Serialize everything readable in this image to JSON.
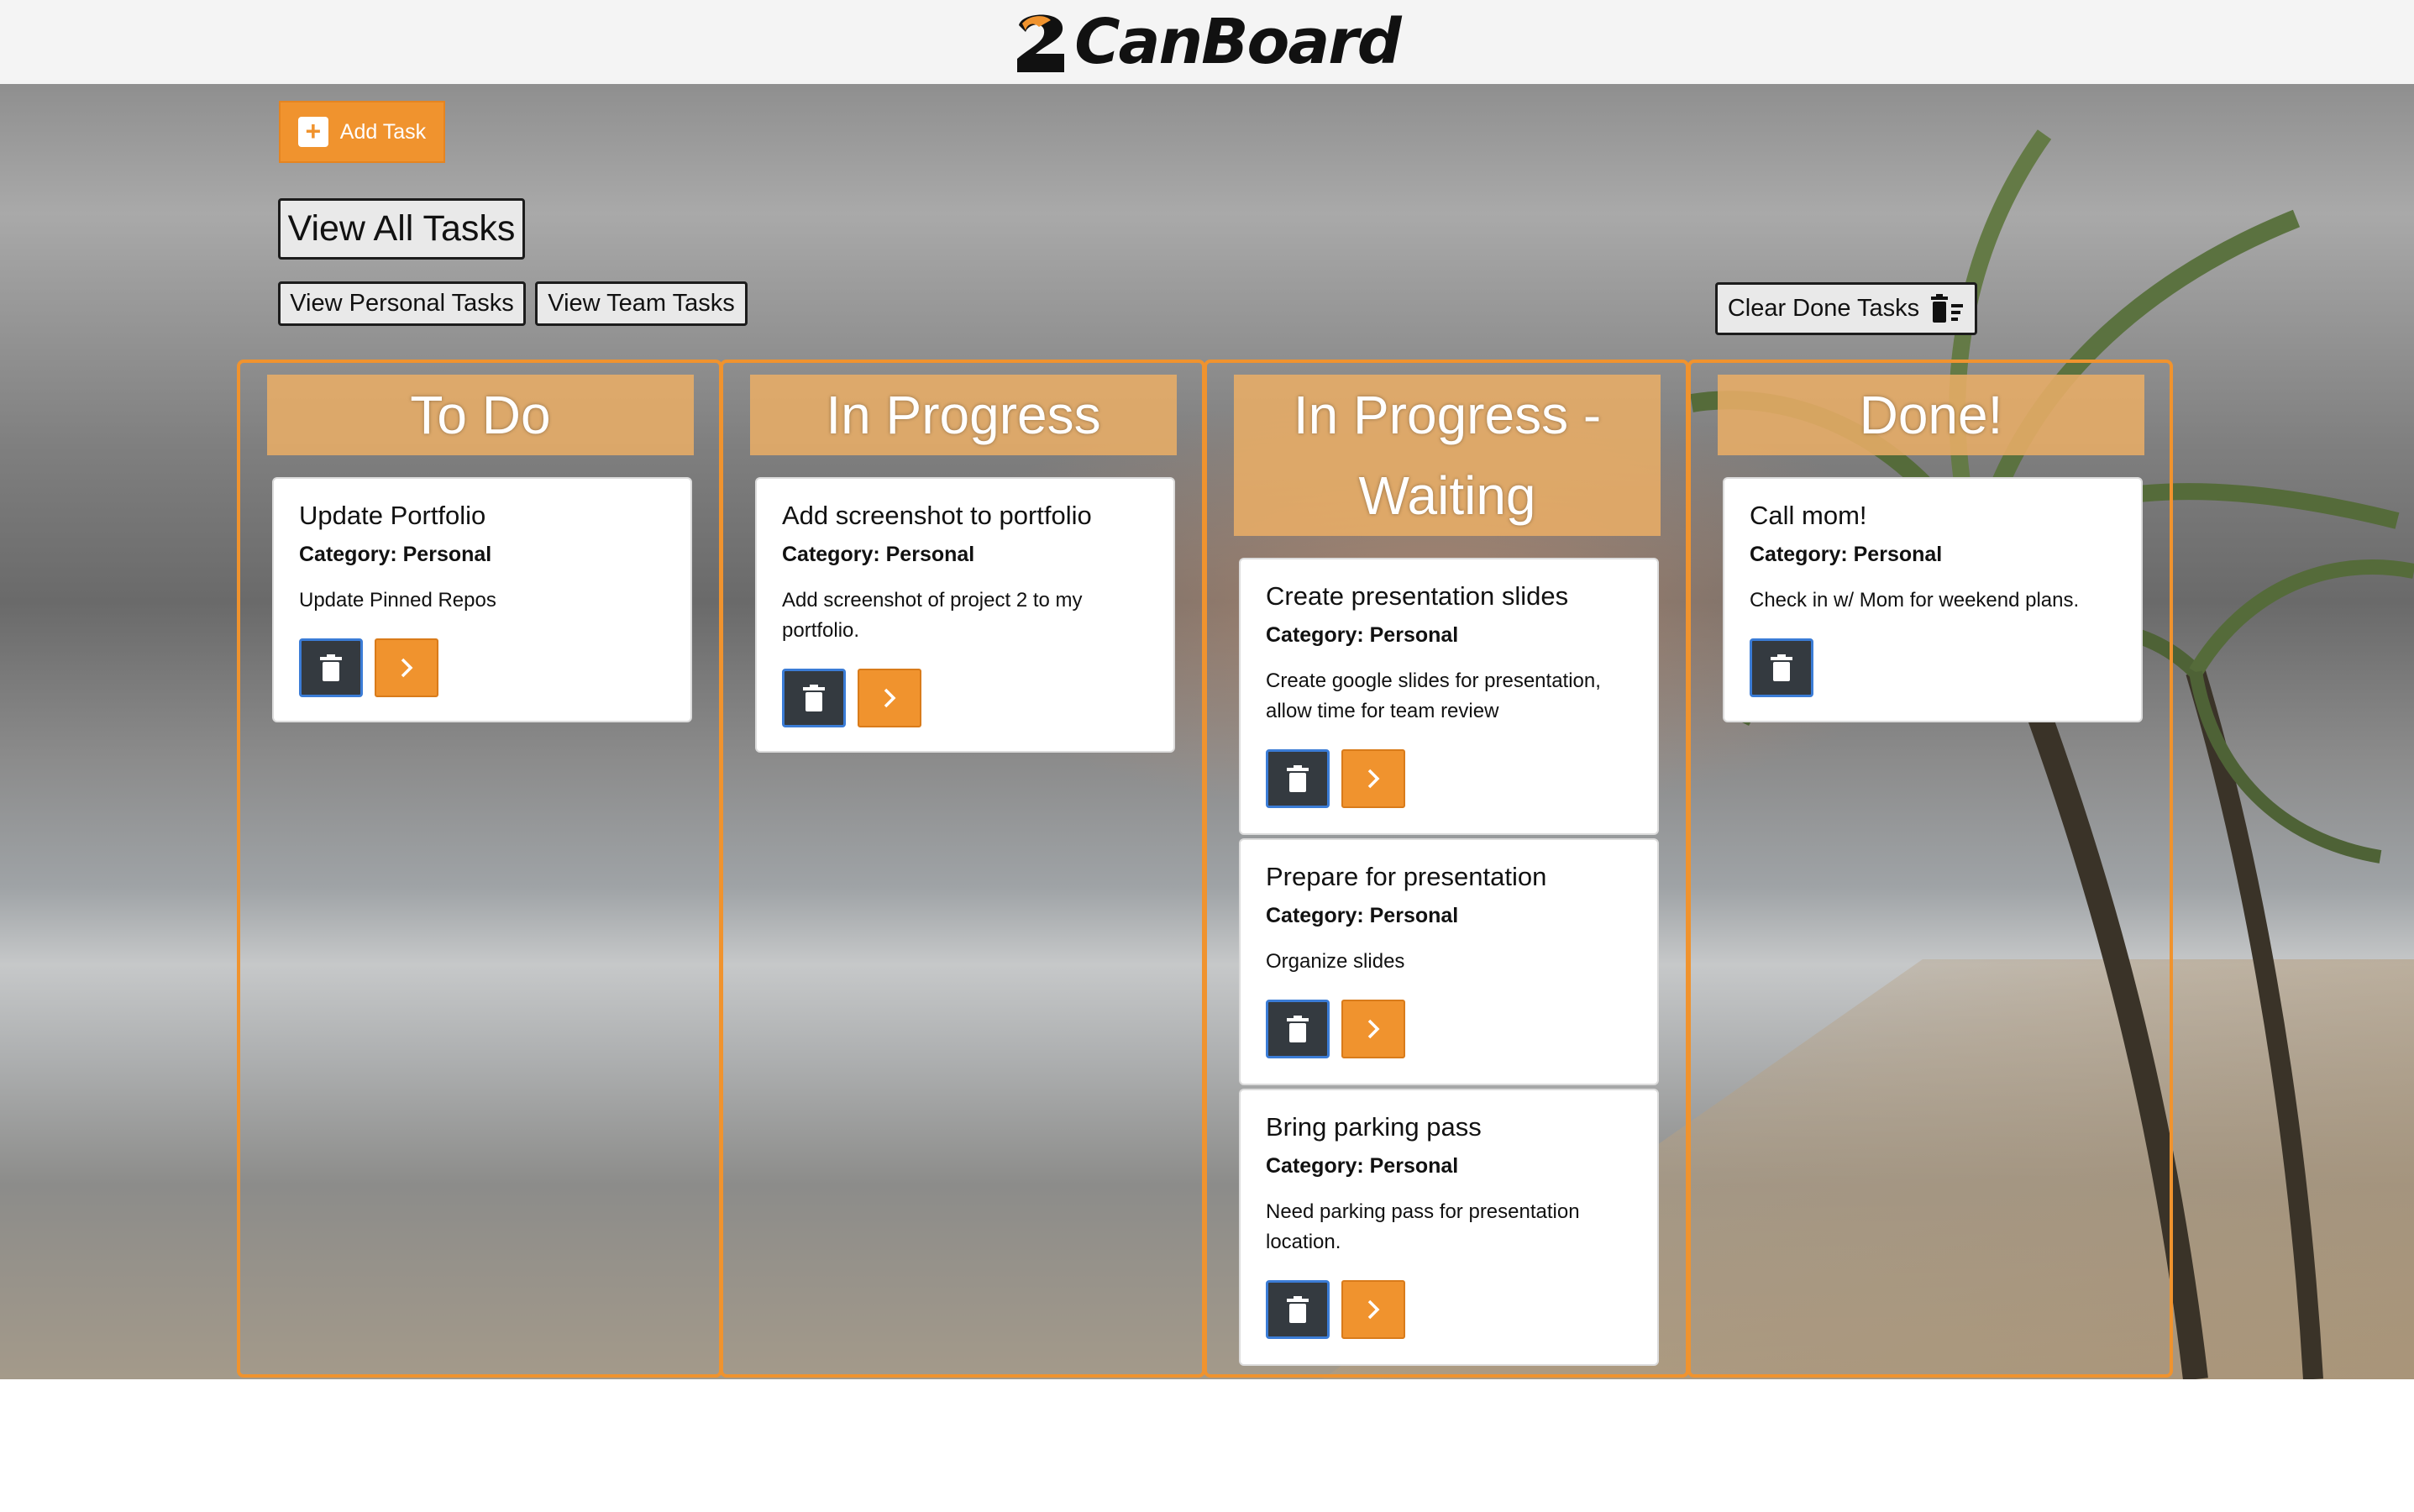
{
  "app": {
    "title": "CanBoard"
  },
  "toolbar": {
    "add_task_label": "Add Task",
    "view_all_label": "View All Tasks",
    "view_personal_label": "View Personal Tasks",
    "view_team_label": "View Team Tasks",
    "clear_done_label": "Clear Done Tasks"
  },
  "colors": {
    "accent": "#f0932e",
    "header_bg": "#e8ad66",
    "dark_button": "#343a40"
  },
  "columns": [
    {
      "title": "To Do",
      "cards": [
        {
          "title": "Update Portfolio",
          "category": "Category: Personal",
          "description": "Update Pinned Repos"
        }
      ]
    },
    {
      "title": "In Progress",
      "cards": [
        {
          "title": "Add screenshot to portfolio",
          "category": "Category: Personal",
          "description_lines": [
            "Add screenshot of project 2 to my",
            "portfolio."
          ]
        }
      ]
    },
    {
      "title_lines": [
        "In Progress -",
        "Waiting"
      ],
      "cards": [
        {
          "title": "Create presentation slides",
          "category": "Category: Personal",
          "description_lines": [
            "Create google slides for presentation,",
            "allow time for team review"
          ]
        },
        {
          "title": "Prepare for presentation",
          "category": "Category: Personal",
          "description": "Organize slides"
        },
        {
          "title": "Bring parking pass",
          "category": "Category: Personal",
          "description_lines": [
            "Need parking pass for presentation",
            "location."
          ]
        }
      ]
    },
    {
      "title": "Done!",
      "cards": [
        {
          "title": "Call mom!",
          "category": "Category: Personal",
          "description": "Check in w/ Mom for weekend plans."
        }
      ]
    }
  ]
}
